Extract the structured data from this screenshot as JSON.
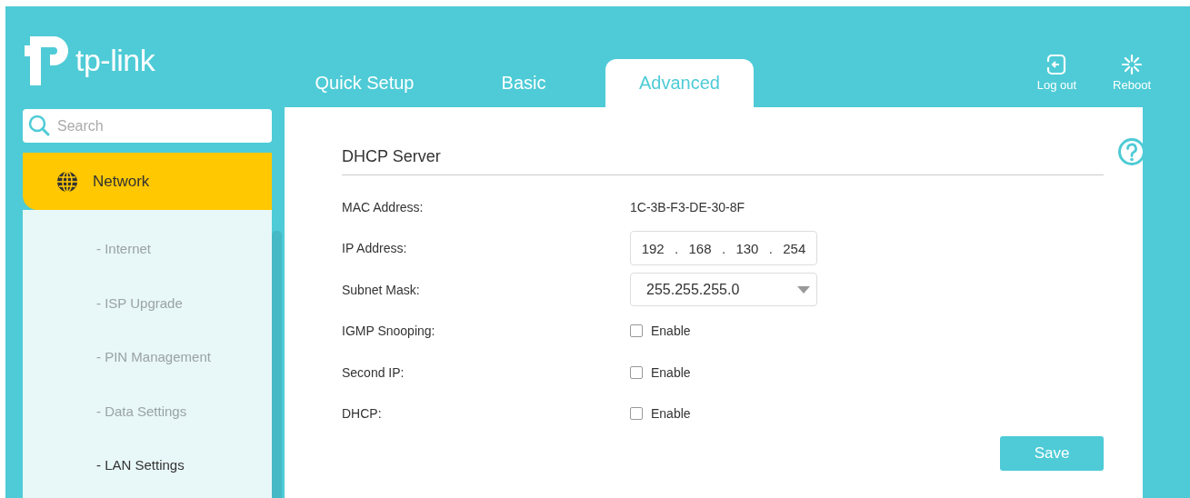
{
  "logo": {
    "text": "tp-link"
  },
  "tabs": [
    {
      "label": "Quick Setup",
      "selected": false
    },
    {
      "label": "Basic",
      "selected": false
    },
    {
      "label": "Advanced",
      "selected": true
    }
  ],
  "header_actions": [
    {
      "kind": "logout",
      "label": "Log out"
    },
    {
      "kind": "reboot",
      "label": "Reboot"
    }
  ],
  "search": {
    "placeholder": "Search"
  },
  "sidebar": {
    "items": [
      {
        "label": "Network",
        "selected": true,
        "expanded": true,
        "children": [
          {
            "label": "- Internet",
            "selected": false
          },
          {
            "label": "- ISP Upgrade",
            "selected": false
          },
          {
            "label": "- PIN Management",
            "selected": false
          },
          {
            "label": "- Data Settings",
            "selected": false
          },
          {
            "label": "- LAN Settings",
            "selected": true
          }
        ]
      }
    ]
  },
  "panel": {
    "title": "DHCP Server",
    "rows": [
      {
        "kind": "text",
        "label": "MAC Address:",
        "value": "1C-3B-F3-DE-30-8F"
      },
      {
        "kind": "ip",
        "label": "IP Address:",
        "octets": [
          "192",
          "168",
          "130",
          "254"
        ],
        "separator": "."
      },
      {
        "kind": "select",
        "label": "Subnet Mask:",
        "value": "255.255.255.0"
      },
      {
        "kind": "checkbox",
        "label": "IGMP Snooping:",
        "option": "Enable",
        "checked": false
      },
      {
        "kind": "checkbox",
        "label": "Second IP:",
        "option": "Enable",
        "checked": false
      },
      {
        "kind": "checkbox",
        "label": "DHCP:",
        "option": "Enable",
        "checked": false
      }
    ],
    "save_button": "Save"
  }
}
